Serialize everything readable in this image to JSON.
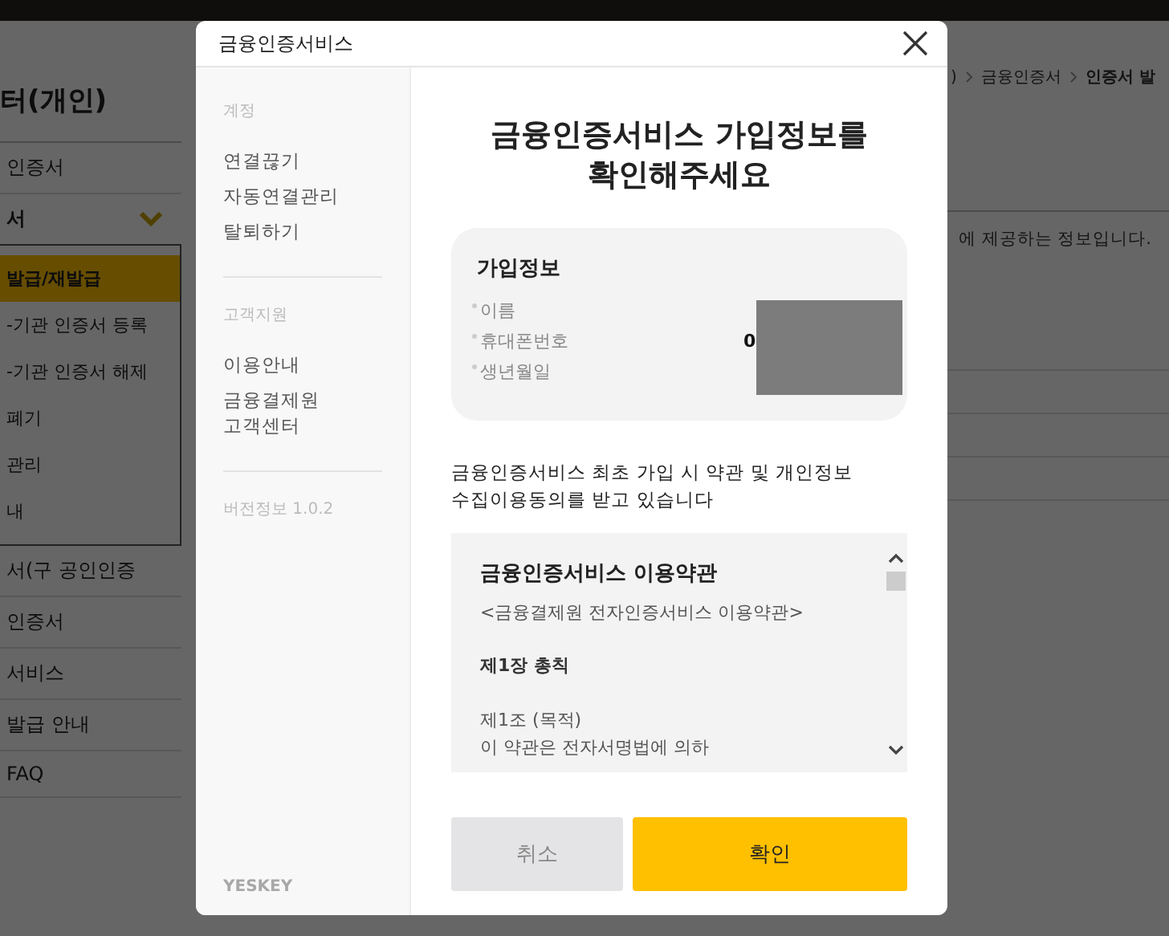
{
  "page": {
    "sidebar_title": "터(개인)",
    "sidebar_items": [
      {
        "label": "인증서",
        "kind": "item"
      },
      {
        "label": "서",
        "kind": "group",
        "expanded": true,
        "children": [
          {
            "label": "발급/재발급",
            "selected": true
          },
          {
            "label": "-기관 인증서 등록",
            "selected": false
          },
          {
            "label": "-기관 인증서 해제",
            "selected": false
          },
          {
            "label": "폐기",
            "selected": false
          },
          {
            "label": "관리",
            "selected": false
          },
          {
            "label": "내",
            "selected": false
          }
        ]
      },
      {
        "label": "서(구 공인인증",
        "kind": "item"
      },
      {
        "label": "인증서",
        "kind": "item"
      },
      {
        "label": "서비스",
        "kind": "item"
      },
      {
        "label": "발급 안내",
        "kind": "item"
      },
      {
        "label": "FAQ",
        "kind": "item"
      }
    ],
    "breadcrumb": [
      ")",
      "금융인증서",
      "인증서 발"
    ],
    "notice": "에 제공하는 정보입니다."
  },
  "dialog": {
    "title": "금융인증서비스",
    "nav_sections": [
      {
        "heading": "계정",
        "items": [
          "연결끊기",
          "자동연결관리",
          "탈퇴하기"
        ]
      },
      {
        "heading": "고객지원",
        "items": [
          "이용안내",
          "금융결제원\n고객센터"
        ]
      }
    ],
    "version": "버전정보 1.0.2",
    "logo": "YESKEY",
    "heading": "금융인증서비스 가입정보를\n확인해주세요",
    "info_title": "가입정보",
    "info_fields": [
      {
        "label": "이름"
      },
      {
        "label": "휴대폰번호",
        "value": "0"
      },
      {
        "label": "생년월일"
      }
    ],
    "redacted": true,
    "consent_text": "금융인증서비스 최초 가입 시 약관 및 개인정보\n수집이용동의를 받고 있습니다",
    "terms": [
      {
        "kind": "title",
        "text": "금융인증서비스 이용약관"
      },
      {
        "kind": "subtitle",
        "text": "<금융결제원 전자인증서비스 이용약관>"
      },
      {
        "kind": "chapter",
        "text": "제1장 총칙"
      },
      {
        "kind": "article",
        "text": "제1조 (목적)"
      },
      {
        "kind": "body",
        "text": "이 약관은 전자서명법에 의하"
      }
    ],
    "buttons": [
      {
        "label": "취소",
        "kind": "secondary"
      },
      {
        "label": "확인",
        "kind": "primary"
      }
    ]
  }
}
